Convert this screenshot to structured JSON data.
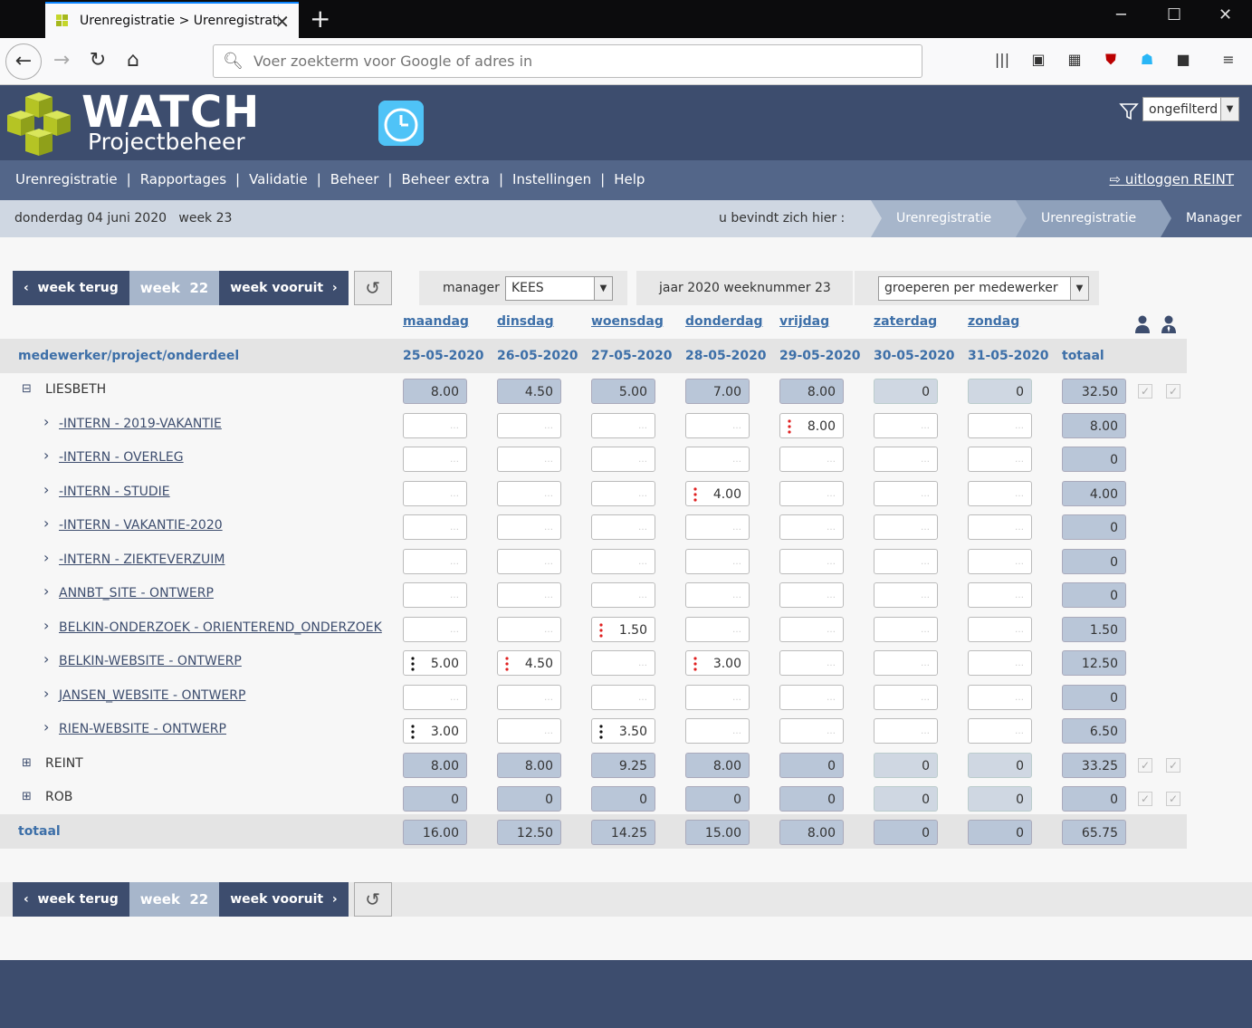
{
  "browser": {
    "tab_title": "Urenregistratie > Urenregistrati",
    "url_placeholder": "Voer zoekterm voor Google of adres in"
  },
  "app": {
    "logo_title": "WATCH",
    "logo_subtitle": "Projectbeheer",
    "filter_value": "ongefilterd",
    "menu": [
      "Urenregistratie",
      "Rapportages",
      "Validatie",
      "Beheer",
      "Beheer extra",
      "Instellingen",
      "Help"
    ],
    "logout": "uitloggen REINT",
    "date": "donderdag 04 juni 2020",
    "week": "week 23",
    "here_label": "u bevindt zich hier :",
    "breadcrumb": [
      "Urenregistratie",
      "Urenregistratie",
      "Manager"
    ]
  },
  "toolbar": {
    "prev": "week terug",
    "current_label": "week",
    "current_week": "22",
    "next": "week vooruit",
    "manager_label": "manager",
    "manager_value": "KEES",
    "year_week": "jaar 2020 weeknummer 23",
    "group_value": "groeperen per medewerker"
  },
  "grid": {
    "col_label": "medewerker/project/onderdeel",
    "days": [
      "maandag",
      "dinsdag",
      "woensdag",
      "donderdag",
      "vrijdag",
      "zaterdag",
      "zondag"
    ],
    "dates": [
      "25-05-2020",
      "26-05-2020",
      "27-05-2020",
      "28-05-2020",
      "29-05-2020",
      "30-05-2020",
      "31-05-2020"
    ],
    "total_label": "totaal",
    "rows": [
      {
        "name": "LIESBETH",
        "type": "employee",
        "toggle": "⊟",
        "values": [
          "8.00",
          "4.50",
          "5.00",
          "7.00",
          "8.00",
          "0",
          "0"
        ],
        "total": "32.50"
      },
      {
        "name": "-INTERN - 2019-VAKANTIE",
        "type": "project",
        "values": [
          "",
          "",
          "",
          "",
          "8.00",
          "",
          ""
        ],
        "marks": [
          "",
          "",
          "",
          "",
          "r",
          "",
          ""
        ],
        "total": "8.00"
      },
      {
        "name": "-INTERN - OVERLEG",
        "type": "project",
        "values": [
          "",
          "",
          "",
          "",
          "",
          "",
          ""
        ],
        "marks": [
          "",
          "",
          "",
          "",
          "",
          "",
          ""
        ],
        "total": "0"
      },
      {
        "name": "-INTERN - STUDIE",
        "type": "project",
        "values": [
          "",
          "",
          "",
          "4.00",
          "",
          "",
          ""
        ],
        "marks": [
          "",
          "",
          "",
          "r",
          "",
          "",
          ""
        ],
        "total": "4.00"
      },
      {
        "name": "-INTERN - VAKANTIE-2020",
        "type": "project",
        "values": [
          "",
          "",
          "",
          "",
          "",
          "",
          ""
        ],
        "marks": [
          "",
          "",
          "",
          "",
          "",
          "",
          ""
        ],
        "total": "0"
      },
      {
        "name": "-INTERN - ZIEKTEVERZUIM",
        "type": "project",
        "values": [
          "",
          "",
          "",
          "",
          "",
          "",
          ""
        ],
        "marks": [
          "",
          "",
          "",
          "",
          "",
          "",
          ""
        ],
        "total": "0"
      },
      {
        "name": "ANNBT_SITE - ONTWERP",
        "type": "project",
        "values": [
          "",
          "",
          "",
          "",
          "",
          "",
          ""
        ],
        "marks": [
          "",
          "",
          "",
          "",
          "",
          "",
          ""
        ],
        "total": "0"
      },
      {
        "name": "BELKIN-ONDERZOEK - ORIENTEREND_ONDERZOEK",
        "type": "project",
        "values": [
          "",
          "",
          "1.50",
          "",
          "",
          "",
          ""
        ],
        "marks": [
          "",
          "",
          "r",
          "",
          "",
          "",
          ""
        ],
        "total": "1.50"
      },
      {
        "name": "BELKIN-WEBSITE - ONTWERP",
        "type": "project",
        "values": [
          "5.00",
          "4.50",
          "",
          "3.00",
          "",
          "",
          ""
        ],
        "marks": [
          "k",
          "r",
          "",
          "r",
          "",
          "",
          ""
        ],
        "total": "12.50"
      },
      {
        "name": "JANSEN_WEBSITE - ONTWERP",
        "type": "project",
        "values": [
          "",
          "",
          "",
          "",
          "",
          "",
          ""
        ],
        "marks": [
          "",
          "",
          "",
          "",
          "",
          "",
          ""
        ],
        "total": "0"
      },
      {
        "name": "RIEN-WEBSITE - ONTWERP",
        "type": "project",
        "values": [
          "3.00",
          "",
          "3.50",
          "",
          "",
          "",
          ""
        ],
        "marks": [
          "k",
          "",
          "k",
          "",
          "",
          "",
          ""
        ],
        "total": "6.50"
      },
      {
        "name": "REINT",
        "type": "employee",
        "toggle": "⊞",
        "values": [
          "8.00",
          "8.00",
          "9.25",
          "8.00",
          "0",
          "0",
          "0"
        ],
        "total": "33.25"
      },
      {
        "name": "ROB",
        "type": "employee",
        "toggle": "⊞",
        "values": [
          "0",
          "0",
          "0",
          "0",
          "0",
          "0",
          "0"
        ],
        "total": "0"
      }
    ],
    "totals": {
      "values": [
        "16.00",
        "12.50",
        "14.25",
        "15.00",
        "8.00",
        "0",
        "0"
      ],
      "total": "65.75"
    }
  },
  "colors": {
    "accent": "#3d4d6e",
    "menu": "#536689",
    "link": "#3d6fa8",
    "mark_red": "#e02020"
  }
}
